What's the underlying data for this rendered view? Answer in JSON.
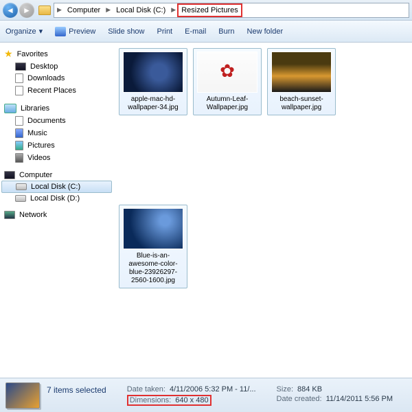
{
  "breadcrumb": {
    "items": [
      "Computer",
      "Local Disk (C:)",
      "Resized Pictures"
    ],
    "highlighted_index": 2
  },
  "toolbar": {
    "organize": "Organize",
    "preview": "Preview",
    "slideshow": "Slide show",
    "print": "Print",
    "email": "E-mail",
    "burn": "Burn",
    "newfolder": "New folder"
  },
  "sidebar": {
    "favorites": {
      "label": "Favorites",
      "items": [
        "Desktop",
        "Downloads",
        "Recent Places"
      ]
    },
    "libraries": {
      "label": "Libraries",
      "items": [
        "Documents",
        "Music",
        "Pictures",
        "Videos"
      ]
    },
    "computer": {
      "label": "Computer",
      "items": [
        "Local Disk (C:)",
        "Local Disk (D:)"
      ],
      "selected_index": 0
    },
    "network": {
      "label": "Network"
    }
  },
  "files": [
    {
      "name": "apple-mac-hd-wallpaper-34.jpg"
    },
    {
      "name": "Autumn-Leaf-Wallpaper.jpg"
    },
    {
      "name": "beach-sunset-wallpaper.jpg"
    },
    {
      "name": "Blue-is-an-awesome-color-blue-23926297-2560-1600.jpg"
    }
  ],
  "status": {
    "selection": "7 items selected",
    "date_taken_label": "Date taken:",
    "date_taken": "4/11/2006 5:32 PM - 11/...",
    "dimensions_label": "Dimensions:",
    "dimensions": "640 x 480",
    "size_label": "Size:",
    "size": "884 KB",
    "date_created_label": "Date created:",
    "date_created": "11/14/2011 5:56 PM"
  }
}
